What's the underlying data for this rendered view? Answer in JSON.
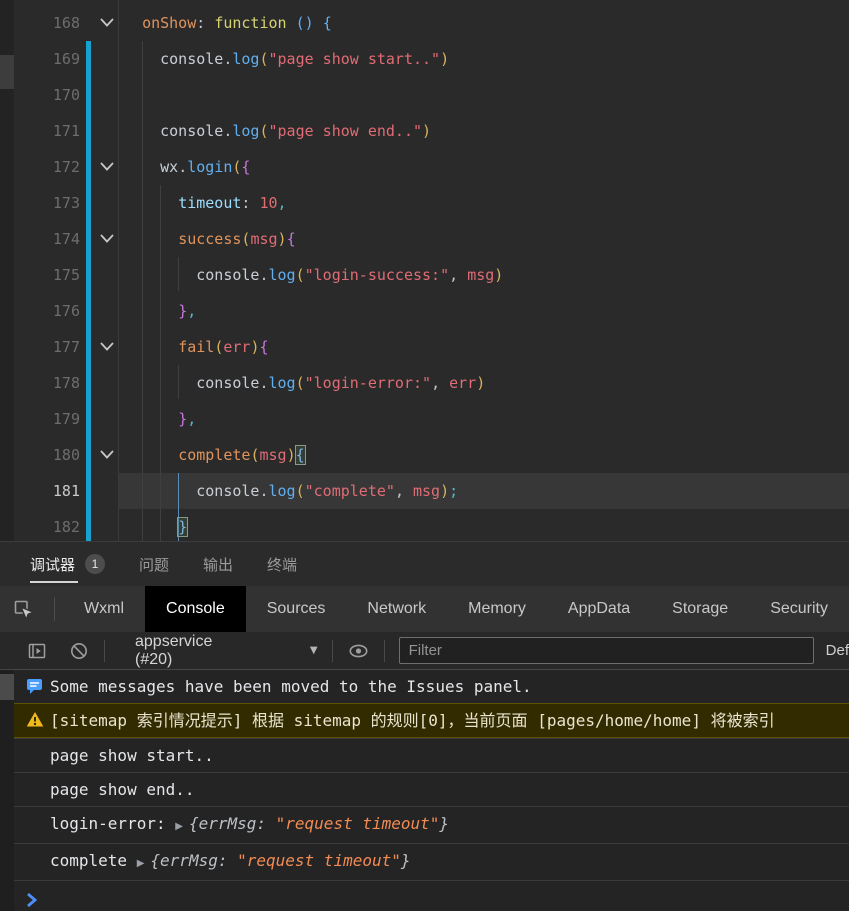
{
  "editor": {
    "current_line": 181,
    "fold_lines": [
      168,
      172,
      174,
      177,
      180
    ],
    "lines": [
      {
        "n": 168,
        "tokens": [
          [
            "  ",
            "pln"
          ],
          [
            "onShow",
            "fn"
          ],
          [
            ":",
            "pun"
          ],
          [
            " ",
            "pln"
          ],
          [
            "function",
            "kw"
          ],
          [
            " ",
            "pln"
          ],
          [
            "()",
            "blue"
          ],
          [
            " ",
            "pln"
          ],
          [
            "{",
            "blue"
          ]
        ]
      },
      {
        "n": 169,
        "tokens": [
          [
            "    ",
            "pln"
          ],
          [
            "console",
            "pln"
          ],
          [
            ".",
            "pun"
          ],
          [
            "log",
            "blue"
          ],
          [
            "(",
            "gold"
          ],
          [
            "\"page show start..\"",
            "str"
          ],
          [
            ")",
            "gold"
          ]
        ]
      },
      {
        "n": 170,
        "tokens": []
      },
      {
        "n": 171,
        "tokens": [
          [
            "    ",
            "pln"
          ],
          [
            "console",
            "pln"
          ],
          [
            ".",
            "pun"
          ],
          [
            "log",
            "blue"
          ],
          [
            "(",
            "gold"
          ],
          [
            "\"page show end..\"",
            "str"
          ],
          [
            ")",
            "gold"
          ]
        ]
      },
      {
        "n": 172,
        "tokens": [
          [
            "    ",
            "pln"
          ],
          [
            "wx",
            "pln"
          ],
          [
            ".",
            "pun"
          ],
          [
            "login",
            "blue"
          ],
          [
            "(",
            "gold"
          ],
          [
            "{",
            "purple"
          ]
        ]
      },
      {
        "n": 173,
        "tokens": [
          [
            "      ",
            "pln"
          ],
          [
            "timeout",
            "prop"
          ],
          [
            ":",
            "pun"
          ],
          [
            " ",
            "pln"
          ],
          [
            "10",
            "red"
          ],
          [
            ",",
            "teal"
          ]
        ]
      },
      {
        "n": 174,
        "tokens": [
          [
            "      ",
            "pln"
          ],
          [
            "success",
            "fn"
          ],
          [
            "(",
            "gold"
          ],
          [
            "msg",
            "red"
          ],
          [
            ")",
            "gold"
          ],
          [
            "{",
            "purple"
          ]
        ]
      },
      {
        "n": 175,
        "tokens": [
          [
            "        ",
            "pln"
          ],
          [
            "console",
            "pln"
          ],
          [
            ".",
            "pun"
          ],
          [
            "log",
            "blue"
          ],
          [
            "(",
            "gold"
          ],
          [
            "\"login-success:\"",
            "str"
          ],
          [
            ",",
            "pun"
          ],
          [
            " ",
            "pln"
          ],
          [
            "msg",
            "red"
          ],
          [
            ")",
            "gold"
          ]
        ]
      },
      {
        "n": 176,
        "tokens": [
          [
            "      ",
            "pln"
          ],
          [
            "}",
            "purple"
          ],
          [
            ",",
            "teal"
          ]
        ]
      },
      {
        "n": 177,
        "tokens": [
          [
            "      ",
            "pln"
          ],
          [
            "fail",
            "fn"
          ],
          [
            "(",
            "gold"
          ],
          [
            "err",
            "red"
          ],
          [
            ")",
            "gold"
          ],
          [
            "{",
            "purple"
          ]
        ]
      },
      {
        "n": 178,
        "tokens": [
          [
            "        ",
            "pln"
          ],
          [
            "console",
            "pln"
          ],
          [
            ".",
            "pun"
          ],
          [
            "log",
            "blue"
          ],
          [
            "(",
            "gold"
          ],
          [
            "\"login-error:\"",
            "str"
          ],
          [
            ",",
            "pun"
          ],
          [
            " ",
            "pln"
          ],
          [
            "err",
            "red"
          ],
          [
            ")",
            "gold"
          ]
        ]
      },
      {
        "n": 179,
        "tokens": [
          [
            "      ",
            "pln"
          ],
          [
            "}",
            "purple"
          ],
          [
            ",",
            "teal"
          ]
        ]
      },
      {
        "n": 180,
        "tokens": [
          [
            "      ",
            "pln"
          ],
          [
            "complete",
            "fn"
          ],
          [
            "(",
            "gold"
          ],
          [
            "msg",
            "red"
          ],
          [
            ")",
            "gold"
          ],
          [
            "{",
            "boxed"
          ]
        ]
      },
      {
        "n": 181,
        "tokens": [
          [
            "        ",
            "pln"
          ],
          [
            "console",
            "pln"
          ],
          [
            ".",
            "pun"
          ],
          [
            "log",
            "blue"
          ],
          [
            "(",
            "gold"
          ],
          [
            "\"complete\"",
            "str"
          ],
          [
            ",",
            "pun"
          ],
          [
            " ",
            "pln"
          ],
          [
            "msg",
            "red"
          ],
          [
            ")",
            "gold"
          ],
          [
            ";",
            "teal"
          ]
        ]
      },
      {
        "n": 182,
        "tokens": [
          [
            "      ",
            "pln"
          ],
          [
            "}",
            "boxed"
          ]
        ]
      }
    ]
  },
  "panel": {
    "tabs": [
      {
        "label": "调试器",
        "badge": "1"
      },
      {
        "label": "问题"
      },
      {
        "label": "输出"
      },
      {
        "label": "终端"
      }
    ]
  },
  "devtools": {
    "tabs": [
      "Wxml",
      "Console",
      "Sources",
      "Network",
      "Memory",
      "AppData",
      "Storage",
      "Security"
    ],
    "active_tab": "Console"
  },
  "toolbar": {
    "context": "appservice (#20)",
    "filter_placeholder": "Filter",
    "levels": "Def"
  },
  "console": {
    "info_text": "Some messages have been moved to the Issues panel.",
    "warning_text": "[sitemap 索引情况提示] 根据 sitemap 的规则[0]，当前页面 [pages/home/home] 将被索引",
    "logs": [
      "page show start..",
      "page show end.."
    ],
    "objects": [
      {
        "label": "login-error: ",
        "preview_open": "{errMsg: ",
        "preview_string": "\"request timeout\"",
        "preview_close": "}"
      },
      {
        "label": "complete ",
        "preview_open": "{errMsg: ",
        "preview_string": "\"request timeout\"",
        "preview_close": "}"
      }
    ]
  },
  "colors": {
    "accent_blue": "#18a0cf",
    "warning_bg": "#332b00",
    "active_tab_bg": "#000000",
    "object_string": "#f28b54",
    "prompt_blue": "#4e8ef7"
  }
}
